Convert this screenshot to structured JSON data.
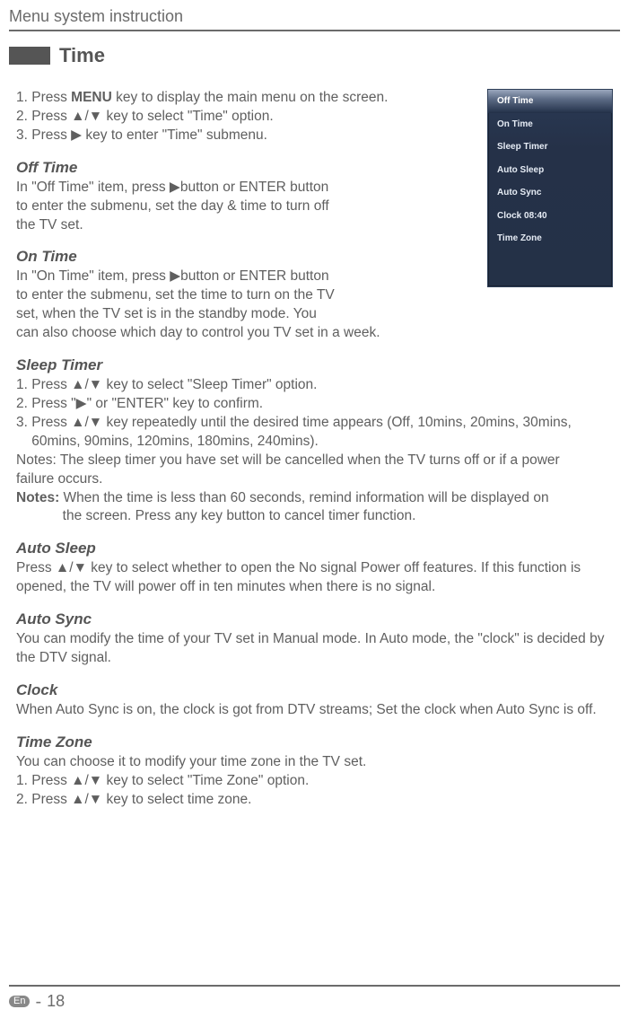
{
  "header": {
    "title": "Menu system instruction"
  },
  "section": {
    "title": "Time"
  },
  "intro": {
    "line1": {
      "prefix": "1. Press ",
      "bold": "MENU",
      "suffix": " key to display the main menu on the screen."
    },
    "line2": "2. Press ▲/▼ key to select \"Time\" option.",
    "line3": "3. Press ▶ key to enter \"Time\" submenu."
  },
  "offTime": {
    "heading": " Off Time",
    "p1": "In \"Off Time\" item, press ▶button or ENTER button",
    "p2": "to enter the submenu, set the day & time to turn off",
    "p3": "the TV set."
  },
  "onTime": {
    "heading": "On Time",
    "p1": "In \"On Time\" item, press ▶button or ENTER button",
    "p2": "to enter the submenu, set the time to turn on the TV",
    "p3": "set, when the TV set is in the standby mode. You",
    "p4": "can also choose which day to control you TV set in a week."
  },
  "sleepTimer": {
    "heading": "Sleep Timer",
    "p1": "1. Press ▲/▼ key to select \"Sleep Timer\" option.",
    "p2": "2. Press \"▶\" or \"ENTER\" key to confirm.",
    "p3a": "3. Press ▲/▼ key repeatedly until the desired time appears (Off, 10mins, 20mins, 30mins,",
    "p3b": "    60mins, 90mins, 120mins, 180mins, 240mins).",
    "p4a": "Notes: The sleep timer you have set will be cancelled when the TV turns off or if a power",
    "p4b": "failure occurs.",
    "p5bold": "Notes:",
    "p5a": " When the time is less than 60 seconds, remind information will be displayed on",
    "p5b": "            the screen. Press any key button to cancel timer function."
  },
  "autoSleep": {
    "heading": "Auto Sleep",
    "p1": "Press ▲/▼ key to select whether to open the No signal Power off features. If this function is opened, the TV will power off  in ten minutes when there is no signal."
  },
  "autoSync": {
    "heading": "Auto Sync",
    "p1": "You can modify the time of your TV set in Manual mode. In Auto mode, the \"clock\" is decided by the DTV signal."
  },
  "clock": {
    "heading": "Clock",
    "p1": "When Auto Sync is on, the clock is got from DTV streams; Set the clock when Auto Sync is off."
  },
  "timeZone": {
    "heading": "Time Zone",
    "p1": "You can choose it to modify your time zone in the TV set.",
    "p2": "1. Press ▲/▼ key to select \"Time Zone\" option.",
    "p3": "2. Press ▲/▼ key to select time zone."
  },
  "menu": {
    "items": [
      {
        "label": "Off Time",
        "selected": true
      },
      {
        "label": "On Time",
        "selected": false
      },
      {
        "label": "Sleep Timer",
        "selected": false
      },
      {
        "label": "Auto Sleep",
        "selected": false
      },
      {
        "label": "Auto Sync",
        "selected": false
      },
      {
        "label": "Clock 08:40",
        "selected": false
      },
      {
        "label": "Time Zone",
        "selected": false
      }
    ]
  },
  "footer": {
    "lang": "En",
    "dash": "-",
    "page": "18"
  }
}
